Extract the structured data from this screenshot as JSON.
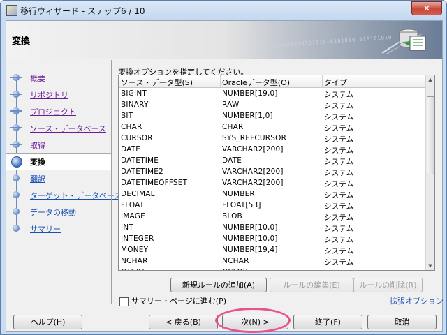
{
  "window": {
    "title": "移行ウィザード - ステップ6 / 10",
    "close_glyph": "✕"
  },
  "banner": {
    "title": "変換",
    "binary_text": "0101010101010101010101010  010101010"
  },
  "nav": {
    "items": [
      {
        "label": "概要",
        "state": "done"
      },
      {
        "label": "リポジトリ",
        "state": "done"
      },
      {
        "label": "プロジェクト",
        "state": "done"
      },
      {
        "label": "ソース・データベース",
        "state": "done"
      },
      {
        "label": "取得",
        "state": "done"
      },
      {
        "label": "変換",
        "state": "current"
      },
      {
        "label": "翻訳",
        "state": "pending"
      },
      {
        "label": "ターゲット・データベース",
        "state": "pending"
      },
      {
        "label": "データの移動",
        "state": "pending"
      },
      {
        "label": "サマリー",
        "state": "pending"
      }
    ]
  },
  "main": {
    "instruction": "変換オプションを指定してください。",
    "columns": [
      "ソース・データ型(S)",
      "Oracleデータ型(O)",
      "タイプ"
    ],
    "rows": [
      [
        "BIGINT",
        "NUMBER[19,0]",
        "システム"
      ],
      [
        "BINARY",
        "RAW",
        "システム"
      ],
      [
        "BIT",
        "NUMBER[1,0]",
        "システム"
      ],
      [
        "CHAR",
        "CHAR",
        "システム"
      ],
      [
        "CURSOR",
        "SYS_REFCURSOR",
        "システム"
      ],
      [
        "DATE",
        "VARCHAR2[200]",
        "システム"
      ],
      [
        "DATETIME",
        "DATE",
        "システム"
      ],
      [
        "DATETIME2",
        "VARCHAR2[200]",
        "システム"
      ],
      [
        "DATETIMEOFFSET",
        "VARCHAR2[200]",
        "システム"
      ],
      [
        "DECIMAL",
        "NUMBER",
        "システム"
      ],
      [
        "FLOAT",
        "FLOAT[53]",
        "システム"
      ],
      [
        "IMAGE",
        "BLOB",
        "システム"
      ],
      [
        "INT",
        "NUMBER[10,0]",
        "システム"
      ],
      [
        "INTEGER",
        "NUMBER[10,0]",
        "システム"
      ],
      [
        "MONEY",
        "NUMBER[19,4]",
        "システム"
      ],
      [
        "NCHAR",
        "NCHAR",
        "システム"
      ],
      [
        "NTEXT",
        "NCLOB",
        "システム"
      ]
    ],
    "rule_buttons": {
      "add": "新規ルールの追加(A)",
      "edit": "ルールの編集(E)",
      "delete": "ルールの削除(R)"
    },
    "summary_checkbox": "サマリー・ページに進む(P)",
    "extended_options": "拡張オプション"
  },
  "footer": {
    "help": "ヘルプ(H)",
    "back": "< 戻る(B)",
    "next": "次(N) >",
    "finish": "終了(F)",
    "cancel": "取消"
  },
  "colors": {
    "highlight": "#e8538f",
    "link": "#1a4fb5",
    "visited": "#6a1b9a"
  }
}
